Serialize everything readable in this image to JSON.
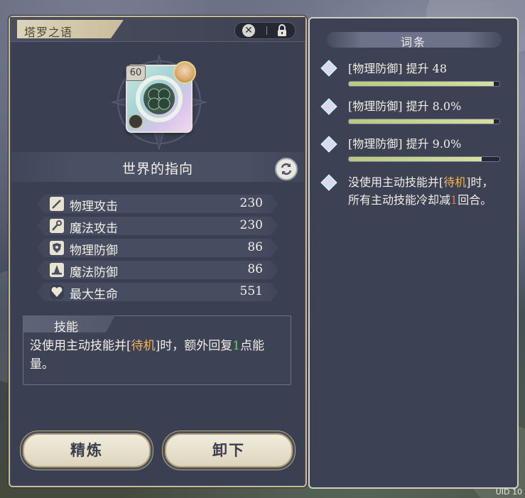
{
  "colors": {
    "panel_bg": "#3a3f52",
    "accent_gold": "#c9bd97",
    "highlight_orange": "#f0b65a",
    "highlight_green": "#6cd45e",
    "highlight_red": "#e5764e"
  },
  "left_panel": {
    "title": "塔罗之语",
    "card": {
      "level": "60"
    },
    "item_name": "世界的指向",
    "stats": [
      {
        "label": "物理攻击",
        "value": "230",
        "icon": "sword-icon"
      },
      {
        "label": "魔法攻击",
        "value": "230",
        "icon": "wand-icon"
      },
      {
        "label": "物理防御",
        "value": "86",
        "icon": "shield-icon"
      },
      {
        "label": "魔法防御",
        "value": "86",
        "icon": "wizard-hat-icon"
      },
      {
        "label": "最大生命",
        "value": "551",
        "icon": "heart-icon"
      }
    ],
    "skill": {
      "title": "技能",
      "text_pre": "没使用主动技能并[",
      "text_hl": "待机",
      "text_mid": "]时，额外回复",
      "text_num": "1",
      "text_post": "点能量。"
    },
    "buttons": {
      "refine": "精炼",
      "unequip": "卸下"
    }
  },
  "right_panel": {
    "title": "词条",
    "affixes": [
      {
        "text": "[物理防御] 提升 48",
        "fill": 0.96
      },
      {
        "text": "[物理防御] 提升 8.0%",
        "fill": 0.96
      },
      {
        "text": "[物理防御] 提升 9.0%",
        "fill": 0.88
      }
    ],
    "passive": {
      "text_pre": "没使用主动技能并[",
      "text_hl": "待机",
      "text_mid": "]时，所有主动技能冷却减",
      "text_num": "1",
      "text_post": "回合。"
    }
  },
  "footer": {
    "uid": "UID 10"
  }
}
